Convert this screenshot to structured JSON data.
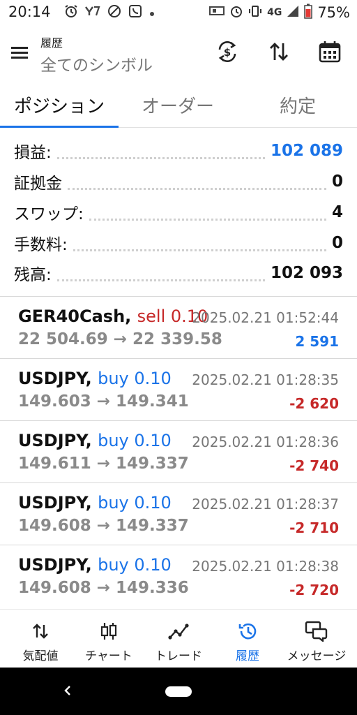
{
  "status_bar": {
    "time": "20:14",
    "network": "4G",
    "battery": "75%"
  },
  "app_bar": {
    "title": "履歴",
    "subtitle": "全てのシンボル"
  },
  "tabs": [
    {
      "label": "ポジション",
      "active": true
    },
    {
      "label": "オーダー",
      "active": false
    },
    {
      "label": "約定",
      "active": false
    }
  ],
  "summary": {
    "profit": {
      "label": "損益:",
      "value": "102 089"
    },
    "deposit": {
      "label": "証拠金",
      "value": "0"
    },
    "swap": {
      "label": "スワップ:",
      "value": "4"
    },
    "commission": {
      "label": "手数料:",
      "value": "0"
    },
    "balance": {
      "label": "残高:",
      "value": "102 093"
    }
  },
  "trades": [
    {
      "symbol": "GER40Cash,",
      "side": "sell 0.10",
      "side_type": "sell",
      "time": "2025.02.21 01:52:44",
      "prices": "22 504.69 → 22 339.58",
      "pl": "2 591",
      "pl_sign": "pos"
    },
    {
      "symbol": "USDJPY,",
      "side": "buy 0.10",
      "side_type": "buy",
      "time": "2025.02.21 01:28:35",
      "prices": "149.603 → 149.341",
      "pl": "-2 620",
      "pl_sign": "neg"
    },
    {
      "symbol": "USDJPY,",
      "side": "buy 0.10",
      "side_type": "buy",
      "time": "2025.02.21 01:28:36",
      "prices": "149.611 → 149.337",
      "pl": "-2 740",
      "pl_sign": "neg"
    },
    {
      "symbol": "USDJPY,",
      "side": "buy 0.10",
      "side_type": "buy",
      "time": "2025.02.21 01:28:37",
      "prices": "149.608 → 149.337",
      "pl": "-2 710",
      "pl_sign": "neg"
    },
    {
      "symbol": "USDJPY,",
      "side": "buy 0.10",
      "side_type": "buy",
      "time": "2025.02.21 01:28:38",
      "prices": "149.608 → 149.336",
      "pl": "-2 720",
      "pl_sign": "neg"
    }
  ],
  "bottom_nav": [
    {
      "label": "気配値",
      "icon": "arrows-updown-icon"
    },
    {
      "label": "チャート",
      "icon": "candlestick-icon"
    },
    {
      "label": "トレード",
      "icon": "trend-line-icon"
    },
    {
      "label": "履歴",
      "icon": "history-icon",
      "active": true
    },
    {
      "label": "メッセージ",
      "icon": "chat-icon"
    }
  ],
  "colors": {
    "accent": "#1a73e8",
    "negative": "#c62828"
  }
}
